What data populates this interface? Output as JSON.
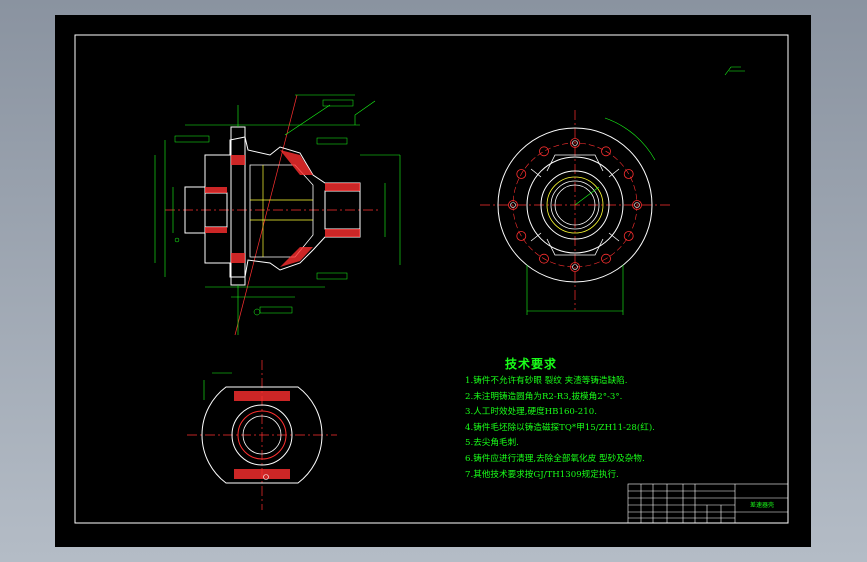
{
  "drawing": {
    "tech_requirements_title": "技术要求",
    "tech_requirements": [
      "1.铸件不允许有砂眼  裂纹  夹渣等铸造缺陷.",
      "2.未注明铸造圆角为R2-R3,拔模角2°-3°.",
      "3.人工时效处理,硬度HB160-210.",
      "4.铸件毛坯除以铸造磁探TQ*甲15/ZH11-28(红).",
      "5.去尖角毛刺.",
      "6.铸件应进行清理,去除全部氧化皮  型砂及杂物.",
      "7.其他技术要求按GJ/TH1309规定执行."
    ],
    "title_block_name": "差速器壳"
  },
  "colors": {
    "frame": "#ffffff",
    "outline": "#ffffff",
    "dimension": "#19ff19",
    "centerline": "#ff3030",
    "hatch": "#ff3030",
    "hidden": "#ffff33",
    "viewport_bg": "#000000",
    "window_bg": "#9aa3ae"
  }
}
